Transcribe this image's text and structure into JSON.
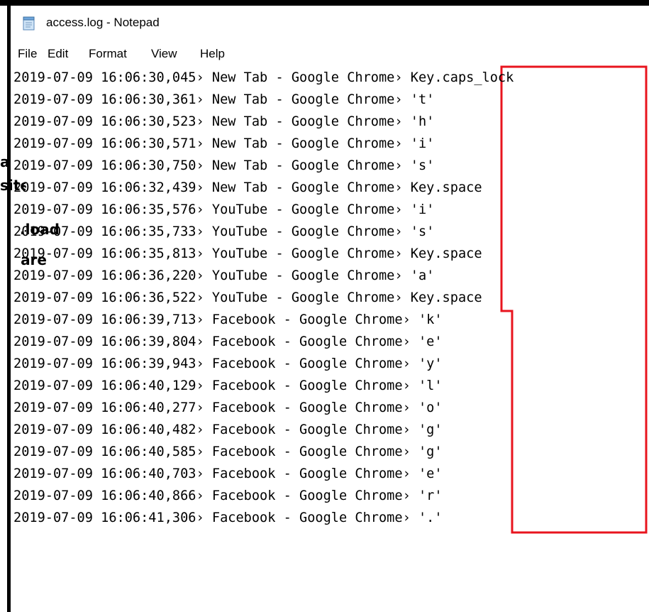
{
  "window": {
    "title": "access.log - Notepad",
    "icon": "notepad-icon"
  },
  "menu": [
    "File",
    "Edit",
    "Format",
    "View",
    "Help"
  ],
  "log": [
    {
      "timestamp": "2019-07-09 16:06:30,045",
      "window": "New Tab - Google Chrome",
      "key": "Key.caps_lock"
    },
    {
      "timestamp": "2019-07-09 16:06:30,361",
      "window": "New Tab - Google Chrome",
      "key": "'t'"
    },
    {
      "timestamp": "2019-07-09 16:06:30,523",
      "window": "New Tab - Google Chrome",
      "key": "'h'"
    },
    {
      "timestamp": "2019-07-09 16:06:30,571",
      "window": "New Tab - Google Chrome",
      "key": "'i'"
    },
    {
      "timestamp": "2019-07-09 16:06:30,750",
      "window": "New Tab - Google Chrome",
      "key": "'s'"
    },
    {
      "timestamp": "2019-07-09 16:06:32,439",
      "window": "New Tab - Google Chrome",
      "key": "Key.space"
    },
    {
      "timestamp": "2019-07-09 16:06:35,576",
      "window": "YouTube - Google Chrome",
      "key": "'i'"
    },
    {
      "timestamp": "2019-07-09 16:06:35,733",
      "window": "YouTube - Google Chrome",
      "key": "'s'"
    },
    {
      "timestamp": "2019-07-09 16:06:35,813",
      "window": "YouTube - Google Chrome",
      "key": "Key.space"
    },
    {
      "timestamp": "2019-07-09 16:06:36,220",
      "window": "YouTube - Google Chrome",
      "key": "'a'"
    },
    {
      "timestamp": "2019-07-09 16:06:36,522",
      "window": "YouTube - Google Chrome",
      "key": "Key.space"
    },
    {
      "timestamp": "2019-07-09 16:06:39,713",
      "window": "Facebook - Google Chrome",
      "key": "'k'"
    },
    {
      "timestamp": "2019-07-09 16:06:39,804",
      "window": "Facebook - Google Chrome",
      "key": "'e'"
    },
    {
      "timestamp": "2019-07-09 16:06:39,943",
      "window": "Facebook - Google Chrome",
      "key": "'y'"
    },
    {
      "timestamp": "2019-07-09 16:06:40,129",
      "window": "Facebook - Google Chrome",
      "key": "'l'"
    },
    {
      "timestamp": "2019-07-09 16:06:40,277",
      "window": "Facebook - Google Chrome",
      "key": "'o'"
    },
    {
      "timestamp": "2019-07-09 16:06:40,482",
      "window": "Facebook - Google Chrome",
      "key": "'g'"
    },
    {
      "timestamp": "2019-07-09 16:06:40,585",
      "window": "Facebook - Google Chrome",
      "key": "'g'"
    },
    {
      "timestamp": "2019-07-09 16:06:40,703",
      "window": "Facebook - Google Chrome",
      "key": "'e'"
    },
    {
      "timestamp": "2019-07-09 16:06:40,866",
      "window": "Facebook - Google Chrome",
      "key": "'r'"
    },
    {
      "timestamp": "2019-07-09 16:06:41,306",
      "window": "Facebook - Google Chrome",
      "key": "'.'"
    }
  ],
  "separator": "›",
  "highlight_color": "#e8141e",
  "overlay_fragments": [
    "a",
    "site",
    "load.",
    "are"
  ]
}
